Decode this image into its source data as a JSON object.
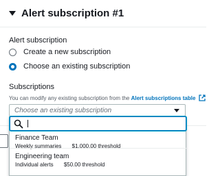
{
  "section": {
    "title": "Alert subscription #1"
  },
  "alert_subscription": {
    "label": "Alert subscription",
    "options": [
      {
        "label": "Create a new subscription",
        "checked": false
      },
      {
        "label": "Choose an existing subscription",
        "checked": true
      }
    ]
  },
  "subscriptions": {
    "label": "Subscriptions",
    "description": "You can modify any existing subscription from the",
    "link_text": "Alert subscriptions table",
    "select_placeholder": "Choose an existing subscription",
    "filter_value": ""
  },
  "dropdown_options": [
    {
      "name": "Finance Team",
      "frequency": "Weekly summaries",
      "threshold": "$1,000.00 threshold"
    },
    {
      "name": "Engineering team",
      "frequency": "Individual alerts",
      "threshold": "$50.00 threshold"
    }
  ],
  "icons": {
    "section_caret": "caret-down-icon",
    "external_link": "external-link-icon",
    "select_caret": "caret-down-icon",
    "search": "search-icon"
  },
  "colors": {
    "link": "#0073bb",
    "focus_ring": "#00a1c9",
    "text": "#16191f",
    "muted": "#545b64"
  }
}
